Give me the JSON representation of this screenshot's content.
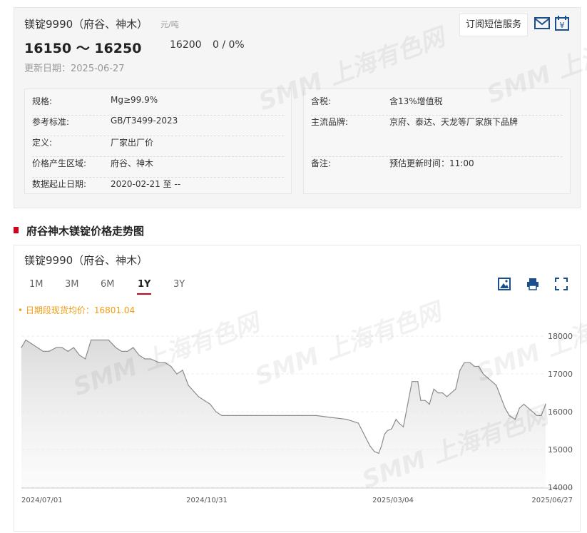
{
  "watermark": "SMM 上海有色网",
  "product": {
    "title": "镁锭9990（府谷、神木）",
    "unit": "元/吨",
    "range": "16150 ～ 16250",
    "average": "16200",
    "change": "0 / 0%",
    "update": "更新日期：2025-06-27",
    "sms_button": "订阅短信服务"
  },
  "icons": {
    "mail": "mail-icon",
    "calendar": "calendar-price-icon"
  },
  "specs_left": [
    {
      "k": "规格:",
      "v": "Mg≥99.9%"
    },
    {
      "k": "参考标准:",
      "v": "GB/T3499-2023"
    },
    {
      "k": "定义:",
      "v": "厂家出厂价"
    },
    {
      "k": "价格产生区域:",
      "v": "府谷、神木"
    },
    {
      "k": "数据起止日期:",
      "v": "2020-02-21 至 --"
    }
  ],
  "specs_right": [
    {
      "k": "含税:",
      "v": "含13%增值税"
    },
    {
      "k": "主流品牌:",
      "v": "京府、泰达、天龙等厂家旗下品牌"
    },
    {
      "k": "备注:",
      "v": "预估更新时间：11:00"
    }
  ],
  "section_title": "府谷神木镁锭价格走势图",
  "chart_panel": {
    "title": "镁锭9990（府谷、神木）",
    "tabs": [
      "1M",
      "3M",
      "6M",
      "1Y",
      "3Y"
    ],
    "active_tab": "1Y",
    "avg_note": "• 日期段现货均价：16801.04",
    "tools": [
      "image-download-icon",
      "print-icon",
      "fullscreen-icon"
    ]
  },
  "colors": {
    "accent": "#d0021b",
    "line": "#8c8c8c",
    "avg_note": "#f39c12"
  },
  "chart_data": {
    "type": "area",
    "title": "",
    "xlabel": "",
    "ylabel": "",
    "ylim": [
      14000,
      18400
    ],
    "yticks": [
      14000,
      15000,
      16000,
      17000,
      18000
    ],
    "xticks": [
      "2024/07/01",
      "2024/10/31",
      "2025/03/04",
      "2025/06/27"
    ],
    "grid": true,
    "legend": "none",
    "x": [
      "2024-07-01",
      "2024-07-04",
      "2024-07-08",
      "2024-07-12",
      "2024-07-16",
      "2024-07-20",
      "2024-07-25",
      "2024-07-29",
      "2024-08-02",
      "2024-08-06",
      "2024-08-10",
      "2024-08-14",
      "2024-08-18",
      "2024-08-22",
      "2024-08-26",
      "2024-08-30",
      "2024-09-04",
      "2024-09-08",
      "2024-09-12",
      "2024-09-16",
      "2024-09-20",
      "2024-09-24",
      "2024-09-28",
      "2024-10-04",
      "2024-10-08",
      "2024-10-12",
      "2024-10-16",
      "2024-10-20",
      "2024-10-24",
      "2024-10-31",
      "2024-11-04",
      "2024-11-08",
      "2024-11-12",
      "2024-11-16",
      "2024-11-20",
      "2024-11-24",
      "2024-11-28",
      "2024-12-02",
      "2024-12-06",
      "2024-12-10",
      "2024-12-20",
      "2024-12-30",
      "2025-01-10",
      "2025-01-20",
      "2025-01-30",
      "2025-02-10",
      "2025-02-18",
      "2025-02-22",
      "2025-02-26",
      "2025-03-01",
      "2025-03-04",
      "2025-03-06",
      "2025-03-08",
      "2025-03-10",
      "2025-03-13",
      "2025-03-16",
      "2025-03-18",
      "2025-03-21",
      "2025-03-24",
      "2025-03-27",
      "2025-03-31",
      "2025-04-02",
      "2025-04-05",
      "2025-04-08",
      "2025-04-11",
      "2025-04-14",
      "2025-04-17",
      "2025-04-20",
      "2025-04-23",
      "2025-04-26",
      "2025-04-29",
      "2025-05-02",
      "2025-05-06",
      "2025-05-09",
      "2025-05-12",
      "2025-05-15",
      "2025-05-18",
      "2025-05-21",
      "2025-05-24",
      "2025-05-27",
      "2025-05-30",
      "2025-06-02",
      "2025-06-06",
      "2025-06-09",
      "2025-06-12",
      "2025-06-15",
      "2025-06-18",
      "2025-06-21",
      "2025-06-24",
      "2025-06-27"
    ],
    "series": [
      {
        "name": "",
        "values": [
          17700,
          17900,
          17800,
          17700,
          17600,
          17600,
          17700,
          17700,
          17600,
          17700,
          17500,
          17400,
          17900,
          17900,
          17900,
          17900,
          17700,
          17600,
          17600,
          17700,
          17500,
          17400,
          17400,
          17300,
          17300,
          17200,
          17000,
          17100,
          16700,
          16400,
          16300,
          16200,
          16000,
          15900,
          15900,
          15900,
          15900,
          15900,
          15900,
          15900,
          15900,
          15900,
          15900,
          15900,
          15850,
          15800,
          15700,
          15400,
          15100,
          14950,
          14900,
          15100,
          15400,
          15500,
          15550,
          15800,
          15700,
          15600,
          16200,
          16800,
          16800,
          16300,
          16300,
          16200,
          16600,
          16500,
          16500,
          16400,
          16500,
          16600,
          17100,
          17300,
          17300,
          17200,
          17200,
          17000,
          16900,
          16800,
          16700,
          16400,
          16100,
          15900,
          15800,
          16100,
          16200,
          16100,
          16000,
          15900,
          15900,
          16200
        ]
      }
    ]
  }
}
